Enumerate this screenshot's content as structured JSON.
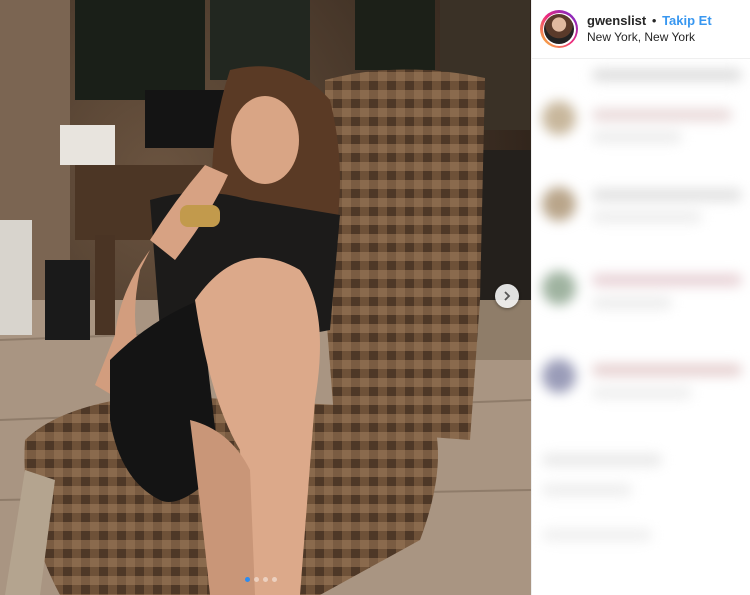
{
  "post": {
    "username": "gwenslist",
    "separator": "•",
    "follow_label": "Takip Et",
    "location": "New York, New York"
  },
  "carousel": {
    "slide_count": 4,
    "active_index": 0,
    "next_icon": "chevron-right-icon"
  },
  "colors": {
    "follow": "#3897f0",
    "dot_active": "#2d8cf0",
    "text": "#262626"
  }
}
